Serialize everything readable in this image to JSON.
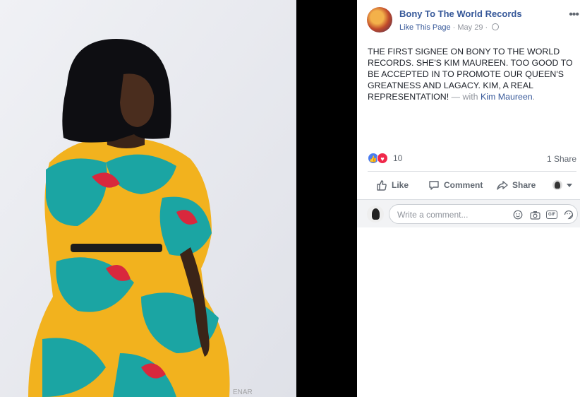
{
  "post": {
    "page_name": "Bony To The World Records",
    "like_page": "Like This Page",
    "separator": "·",
    "date": "May 29",
    "separator2": "·",
    "body": "THE FIRST SIGNEE ON BONY TO THE WORLD RECORDS. SHE'S KIM MAUREEN. TOO GOOD TO BE ACCEPTED IN TO PROMOTE OUR QUEEN'S GREATNESS AND LAGACY. KIM, A REAL REPRESENTATION!",
    "with_label": "— with",
    "tagged_person": "Kim Maureen",
    "tagged_end": "."
  },
  "reactions": {
    "count": "10",
    "shares": "1 Share",
    "types": [
      "like-icon",
      "love-icon"
    ]
  },
  "actions": {
    "like": "Like",
    "comment": "Comment",
    "share": "Share"
  },
  "comment_box": {
    "placeholder": "Write a comment...",
    "gif_label": "GIF"
  },
  "colors": {
    "link": "#365899",
    "muted": "#90949c",
    "text": "#1d2129",
    "like_blue": "#4a7cf1",
    "love_red": "#f0284a"
  },
  "icons": [
    "more-icon",
    "globe-icon",
    "like-thumb-icon",
    "comment-icon",
    "share-arrow-icon",
    "emoji-icon",
    "camera-icon",
    "gif-icon",
    "sticker-icon",
    "chevron-down-icon"
  ]
}
